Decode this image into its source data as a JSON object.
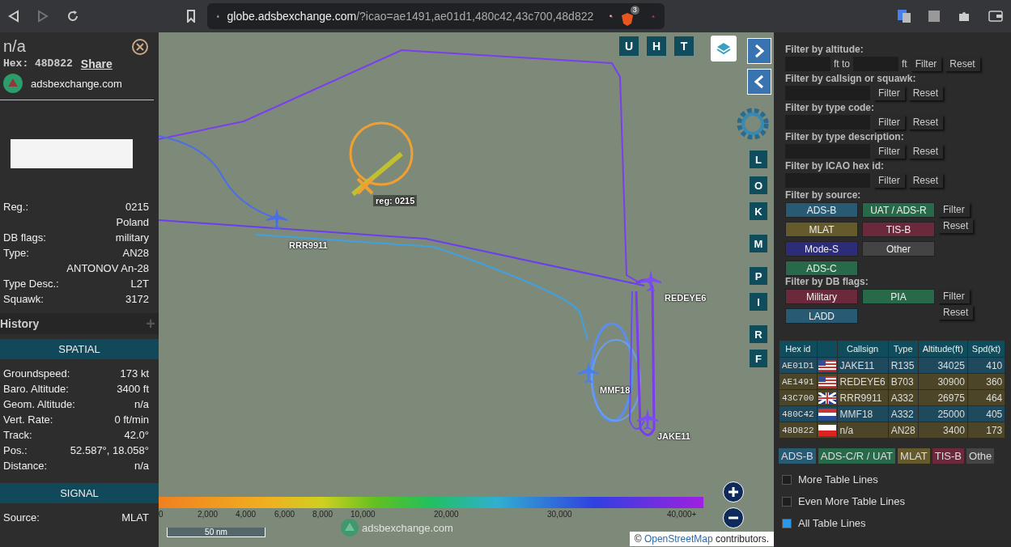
{
  "browser": {
    "url_host": "globe.adsbexchange.com",
    "url_rest": "/?icao=ae1491,ae01d1,480c42,43c700,48d822",
    "shield_count": "3",
    "back_disabled": false,
    "forward_disabled": true
  },
  "sidebar": {
    "title": "n/a",
    "hex_label": "Hex:",
    "hex": "48D822",
    "share": "Share",
    "site": "adsbexchange.com",
    "details": [
      {
        "label": "Reg.:",
        "value": "0215"
      },
      {
        "value": "Poland"
      },
      {
        "label": "DB flags:",
        "value": "military"
      },
      {
        "label": "Type:",
        "value": "AN28"
      },
      {
        "value": "ANTONOV An-28"
      },
      {
        "label": "Type Desc.:",
        "value": "L2T"
      },
      {
        "label": "Squawk:",
        "value": "3172"
      }
    ],
    "history": "History",
    "history_toggle": "+",
    "sections": [
      {
        "title": "SPATIAL",
        "rows": [
          {
            "label": "Groundspeed:",
            "value": "173 kt"
          },
          {
            "label": "Baro. Altitude:",
            "value": "3400 ft"
          },
          {
            "label": "Geom. Altitude:",
            "value": "n/a"
          },
          {
            "label": "Vert. Rate:",
            "value": "0 ft/min"
          },
          {
            "label": "Track:",
            "value": "42.0°"
          },
          {
            "label": "Pos.:",
            "value": "52.587°, 18.058°"
          },
          {
            "label": "Distance:",
            "value": "n/a"
          }
        ]
      },
      {
        "title": "SIGNAL",
        "rows": [
          {
            "label": "Source:",
            "value": "MLAT"
          }
        ]
      }
    ]
  },
  "map": {
    "top_buttons": [
      "U",
      "H",
      "T"
    ],
    "side_buttons": [
      "L",
      "O",
      "K",
      "M",
      "P",
      "I",
      "R",
      "F"
    ],
    "aircraft": [
      {
        "label": "RRR9911",
        "color": "#4a6ee8",
        "kind": "plane"
      },
      {
        "label": "REDEYE6",
        "color": "#7a4ef0",
        "kind": "plane"
      },
      {
        "label": "MMF18",
        "color": "#4a7ee8",
        "kind": "plane"
      },
      {
        "label": "JAKE11",
        "color": "#7a4ef0",
        "kind": "plane"
      },
      {
        "label": "reg: 0215",
        "color": "#f0a030",
        "kind": "selected"
      }
    ],
    "altitude_ticks": [
      "0",
      "2,000",
      "4,000",
      "6,000",
      "8,000",
      "10,000",
      "20,000",
      "30,000",
      "40,000+"
    ],
    "scale": "50 nm",
    "watermark": "adsbexchange.com",
    "attribution": {
      "symbol": "©",
      "link": "OpenStreetMap",
      "text": "contributors."
    }
  },
  "filters": [
    {
      "label": "Filter by altitude:",
      "kind": "range",
      "unit_mid": "ft to",
      "unit_end": "ft",
      "buttons": [
        "Filter",
        "Reset"
      ]
    },
    {
      "label": "Filter by callsign or squawk:",
      "kind": "text",
      "buttons": [
        "Filter",
        "Reset"
      ]
    },
    {
      "label": "Filter by type code:",
      "kind": "text",
      "buttons": [
        "Filter",
        "Reset"
      ]
    },
    {
      "label": "Filter by type description:",
      "kind": "text",
      "buttons": [
        "Filter",
        "Reset"
      ]
    },
    {
      "label": "Filter by ICAO hex id:",
      "kind": "text",
      "buttons": [
        "Filter",
        "Reset"
      ]
    },
    {
      "label": "Filter by source:",
      "kind": "toggles",
      "buttons": [
        "Filter",
        "Reset"
      ],
      "options": [
        {
          "label": "ADS-B",
          "color": "#285a74"
        },
        {
          "label": "UAT / ADS-R",
          "color": "#28694a"
        },
        {
          "label": "MLAT",
          "color": "#655a2c"
        },
        {
          "label": "TIS-B",
          "color": "#6a2a3c"
        },
        {
          "label": "Mode-S",
          "color": "#2c2c78"
        },
        {
          "label": "Other",
          "color": "#444444"
        },
        {
          "label": "ADS-C",
          "color": "#28694a"
        }
      ]
    },
    {
      "label": "Filter by DB flags:",
      "kind": "toggles",
      "buttons": [
        "Filter",
        "Reset"
      ],
      "options": [
        {
          "label": "Military",
          "color": "#6a2a3c"
        },
        {
          "label": "PIA",
          "color": "#28694a"
        },
        {
          "label": "LADD",
          "color": "#285a74"
        }
      ]
    }
  ],
  "table": {
    "columns": [
      "Hex id",
      "Callsign",
      "Type",
      "Altitude(ft)",
      "Spd(kt)"
    ],
    "rows": [
      {
        "hex": "AE01D1",
        "kind": "us",
        "callsign": "JAKE11",
        "type": "R135",
        "altitude": "34025",
        "speed": "410",
        "color": "#1f4a5e"
      },
      {
        "hex": "AE1491",
        "kind": "us",
        "callsign": "REDEYE6",
        "type": "B703",
        "altitude": "30900",
        "speed": "360",
        "color": "#4c4527"
      },
      {
        "hex": "43C700",
        "kind": "gb",
        "callsign": "RRR9911",
        "type": "A332",
        "altitude": "26975",
        "speed": "464",
        "color": "#4c4527"
      },
      {
        "hex": "480C42",
        "kind": "nl",
        "callsign": "MMF18",
        "type": "A332",
        "altitude": "25000",
        "speed": "405",
        "color": "#1f4a5e"
      },
      {
        "hex": "48D822",
        "kind": "pl",
        "callsign": "n/a",
        "type": "AN28",
        "altitude": "3400",
        "speed": "173",
        "color": "#4c4527"
      }
    ]
  },
  "legend": [
    {
      "label": "ADS-B",
      "color": "#285a74"
    },
    {
      "label": "ADS-C/R / UAT",
      "color": "#28694a"
    },
    {
      "label": "MLAT",
      "color": "#655a2c"
    },
    {
      "label": "TIS-B",
      "color": "#6a2a3c"
    },
    {
      "label": "Othe",
      "color": "#444444"
    }
  ],
  "options": [
    {
      "label": "More Table Lines",
      "checked": false
    },
    {
      "label": "Even More Table Lines",
      "checked": false
    },
    {
      "label": "All Table Lines",
      "checked": true
    }
  ]
}
